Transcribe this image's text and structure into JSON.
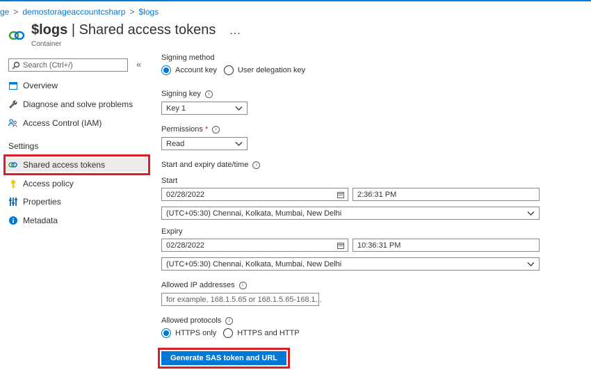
{
  "breadcrumb": {
    "item1": "ge",
    "item2": "demostorageaccountcsharp",
    "item3": "$logs"
  },
  "header": {
    "title_bold": "$logs",
    "title_rest": "| Shared access tokens",
    "more": "...",
    "subtitle": "Container"
  },
  "sidebar": {
    "search_placeholder": "Search (Ctrl+/)",
    "collapse_glyph": "«",
    "items": [
      {
        "label": "Overview",
        "icon": "overview-icon"
      },
      {
        "label": "Diagnose and solve problems",
        "icon": "wrench-icon"
      },
      {
        "label": "Access Control (IAM)",
        "icon": "people-icon"
      }
    ],
    "section_label": "Settings",
    "settings_items": [
      {
        "label": "Shared access tokens",
        "icon": "link-icon",
        "selected": true
      },
      {
        "label": "Access policy",
        "icon": "key-icon"
      },
      {
        "label": "Properties",
        "icon": "properties-icon"
      },
      {
        "label": "Metadata",
        "icon": "info-icon"
      }
    ]
  },
  "form": {
    "signing_method": {
      "label": "Signing method",
      "options": [
        "Account key",
        "User delegation key"
      ],
      "selected": "Account key"
    },
    "signing_key": {
      "label": "Signing key",
      "value": "Key 1"
    },
    "permissions": {
      "label": "Permissions",
      "required_mark": "*",
      "value": "Read"
    },
    "date_section_label": "Start and expiry date/time",
    "start": {
      "label": "Start",
      "date": "02/28/2022",
      "time": "2:36:31 PM",
      "timezone": "(UTC+05:30) Chennai, Kolkata, Mumbai, New Delhi"
    },
    "expiry": {
      "label": "Expiry",
      "date": "02/28/2022",
      "time": "10:36:31 PM",
      "timezone": "(UTC+05:30) Chennai, Kolkata, Mumbai, New Delhi"
    },
    "allowed_ip": {
      "label": "Allowed IP addresses",
      "placeholder": "for example, 168.1.5.65 or 168.1.5.65-168.1..."
    },
    "protocols": {
      "label": "Allowed protocols",
      "options": [
        "HTTPS only",
        "HTTPS and HTTP"
      ],
      "selected": "HTTPS only"
    },
    "generate_button": "Generate SAS token and URL"
  },
  "colors": {
    "accent": "#0078d4",
    "highlight_box": "#d81f26",
    "selected_bg": "#edebe9"
  }
}
